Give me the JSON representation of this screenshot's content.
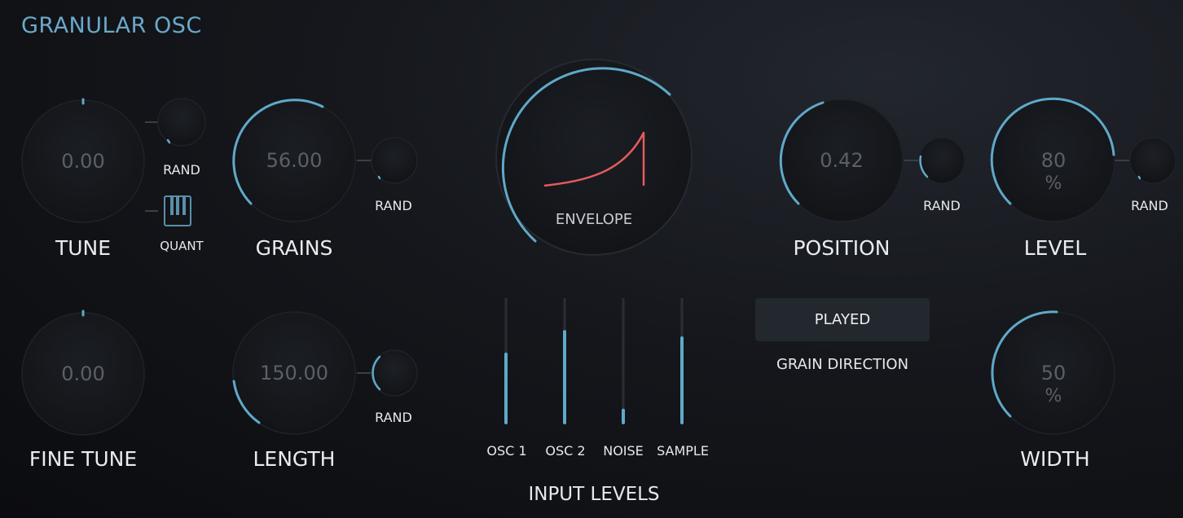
{
  "title": "GRANULAR OSC",
  "colors": {
    "accent": "#5fa9c9",
    "envelope": "#e45b5b",
    "label": "#e9ecef",
    "value": "#5c6066"
  },
  "knobs": {
    "tune": {
      "label": "TUNE",
      "value": "0.00"
    },
    "fine_tune": {
      "label": "FINE TUNE",
      "value": "0.00"
    },
    "grains": {
      "label": "GRAINS",
      "value": "56.00"
    },
    "length": {
      "label": "LENGTH",
      "value": "150.00"
    },
    "position": {
      "label": "POSITION",
      "value": "0.42"
    },
    "level": {
      "label": "LEVEL",
      "value": "80",
      "unit": "%"
    },
    "width": {
      "label": "WIDTH",
      "value": "50",
      "unit": "%"
    }
  },
  "rand_label": "RAND",
  "quant_label": "QUANT",
  "envelope": {
    "label": "ENVELOPE"
  },
  "grain_direction": {
    "button": "PLAYED",
    "label": "GRAIN DIRECTION"
  },
  "input_levels": {
    "label": "INPUT LEVELS",
    "channels": [
      {
        "name": "OSC 1",
        "level": 0.55
      },
      {
        "name": "OSC 2",
        "level": 0.73
      },
      {
        "name": "NOISE",
        "level": 0.1
      },
      {
        "name": "SAMPLE",
        "level": 0.68
      }
    ]
  }
}
